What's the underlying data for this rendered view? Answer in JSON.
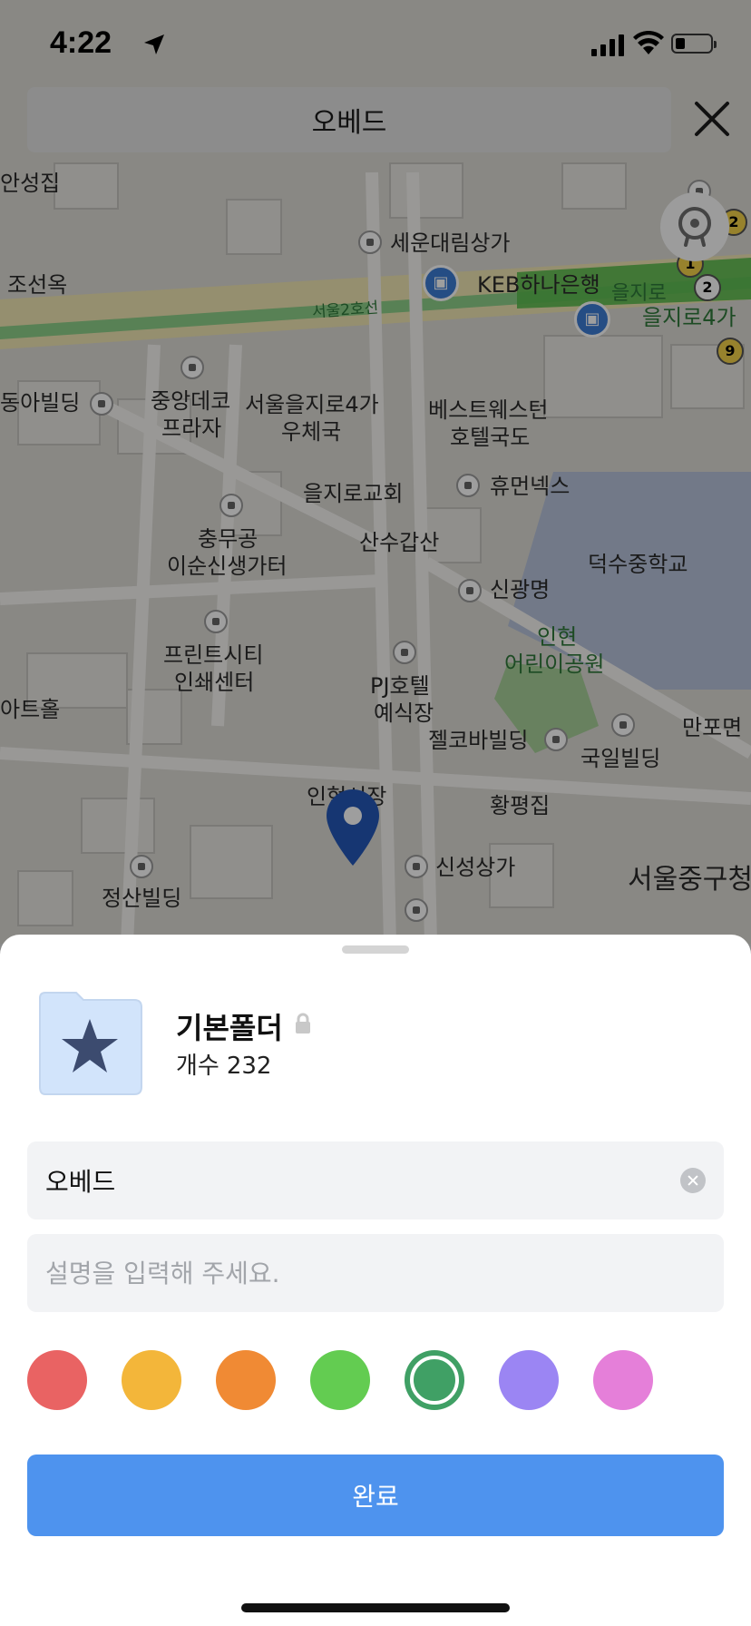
{
  "status_bar": {
    "time": "4:22"
  },
  "search": {
    "query": "오베드"
  },
  "map": {
    "labels": [
      "안성집",
      "조선옥",
      "세운대림상가",
      "KEB하나은행",
      "을지로",
      "을지로4가",
      "서울2호선",
      "동아빌딩",
      "중앙데코",
      "프라자",
      "서울을지로4가",
      "우체국",
      "베스트웨스턴",
      "호텔국도",
      "을지로교회",
      "휴먼넥스",
      "충무공",
      "이순신생가터",
      "산수갑산",
      "덕수중학교",
      "신광명",
      "인현",
      "어린이공원",
      "프린트시티",
      "인쇄센터",
      "PJ호텔",
      "예식장",
      "아트홀",
      "만포면",
      "젤코바빌딩",
      "국일빌딩",
      "인현시장",
      "황평집",
      "신성상가",
      "정산빌딩",
      "서울중구청"
    ],
    "subway_numbers": [
      "1",
      "2",
      "2",
      "9"
    ]
  },
  "folder": {
    "name": "기본폴더",
    "count_label": "개수",
    "count": "232"
  },
  "form": {
    "name_value": "오베드",
    "description_placeholder": "설명을 입력해 주세요."
  },
  "colors": [
    "#e96363",
    "#f3b63a",
    "#f08a34",
    "#63cc51",
    "#40a065",
    "#9b85f3",
    "#e57fd9"
  ],
  "selected_color_index": 4,
  "done_label": "완료"
}
